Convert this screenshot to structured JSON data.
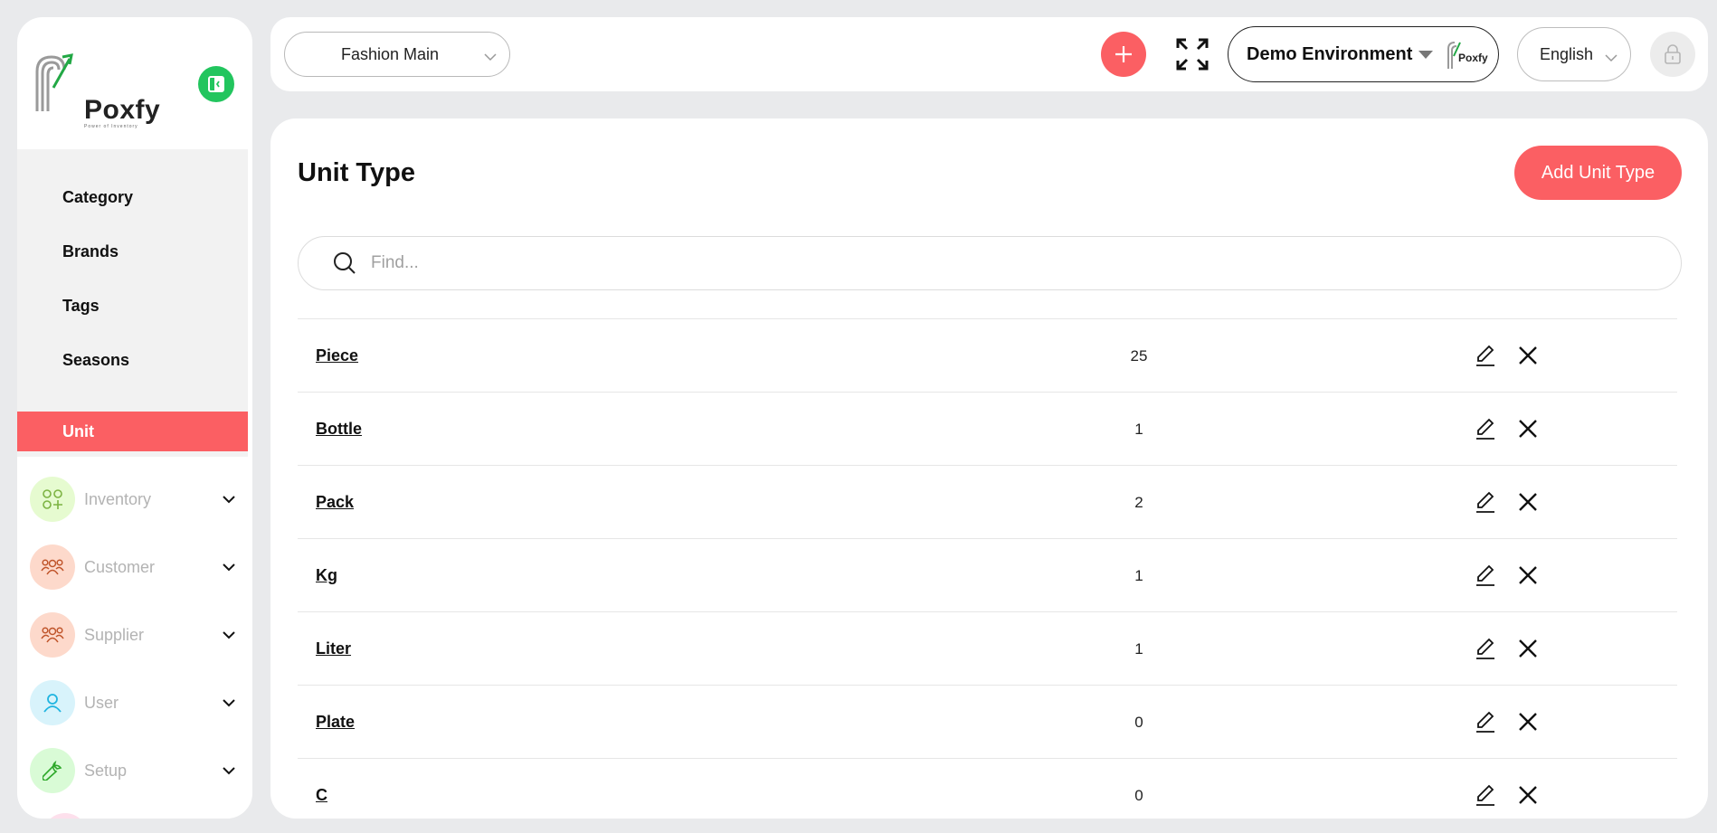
{
  "sidebar": {
    "logo_text": "Poxfy",
    "logo_tagline": "Power of Inventory",
    "submenu": [
      {
        "label": "Category",
        "active": false
      },
      {
        "label": "Brands",
        "active": false
      },
      {
        "label": "Tags",
        "active": false
      },
      {
        "label": "Seasons",
        "active": false
      },
      {
        "label": "Unit",
        "active": true
      }
    ],
    "nav": [
      {
        "label": "Inventory",
        "icon": "apps-plus-icon",
        "bg": "#e6fbd0",
        "color": "#7cb342"
      },
      {
        "label": "Customer",
        "icon": "users-group-icon",
        "bg": "#fdd9cb",
        "color": "#c0552b"
      },
      {
        "label": "Supplier",
        "icon": "users-group-icon",
        "bg": "#fdd9cb",
        "color": "#c0552b"
      },
      {
        "label": "User",
        "icon": "user-icon",
        "bg": "#d8f3fb",
        "color": "#1fb4e0"
      },
      {
        "label": "Setup",
        "icon": "wrench-icon",
        "bg": "#d9fbd6",
        "color": "#2ea82a"
      }
    ]
  },
  "topbar": {
    "branch": "Fashion Main",
    "environment": "Demo Environment",
    "env_logo_text": "Poxfy",
    "language": "English"
  },
  "main": {
    "title": "Unit Type",
    "add_button": "Add Unit Type",
    "search_placeholder": "Find...",
    "rows": [
      {
        "name": "Piece",
        "count": "25"
      },
      {
        "name": "Bottle",
        "count": "1"
      },
      {
        "name": "Pack",
        "count": "2"
      },
      {
        "name": "Kg",
        "count": "1"
      },
      {
        "name": "Liter",
        "count": "1"
      },
      {
        "name": "Plate",
        "count": "0"
      },
      {
        "name": "C",
        "count": "0"
      }
    ]
  },
  "colors": {
    "accent": "#fb5f63",
    "green": "#22c55e",
    "page_bg": "#e9eaec"
  }
}
